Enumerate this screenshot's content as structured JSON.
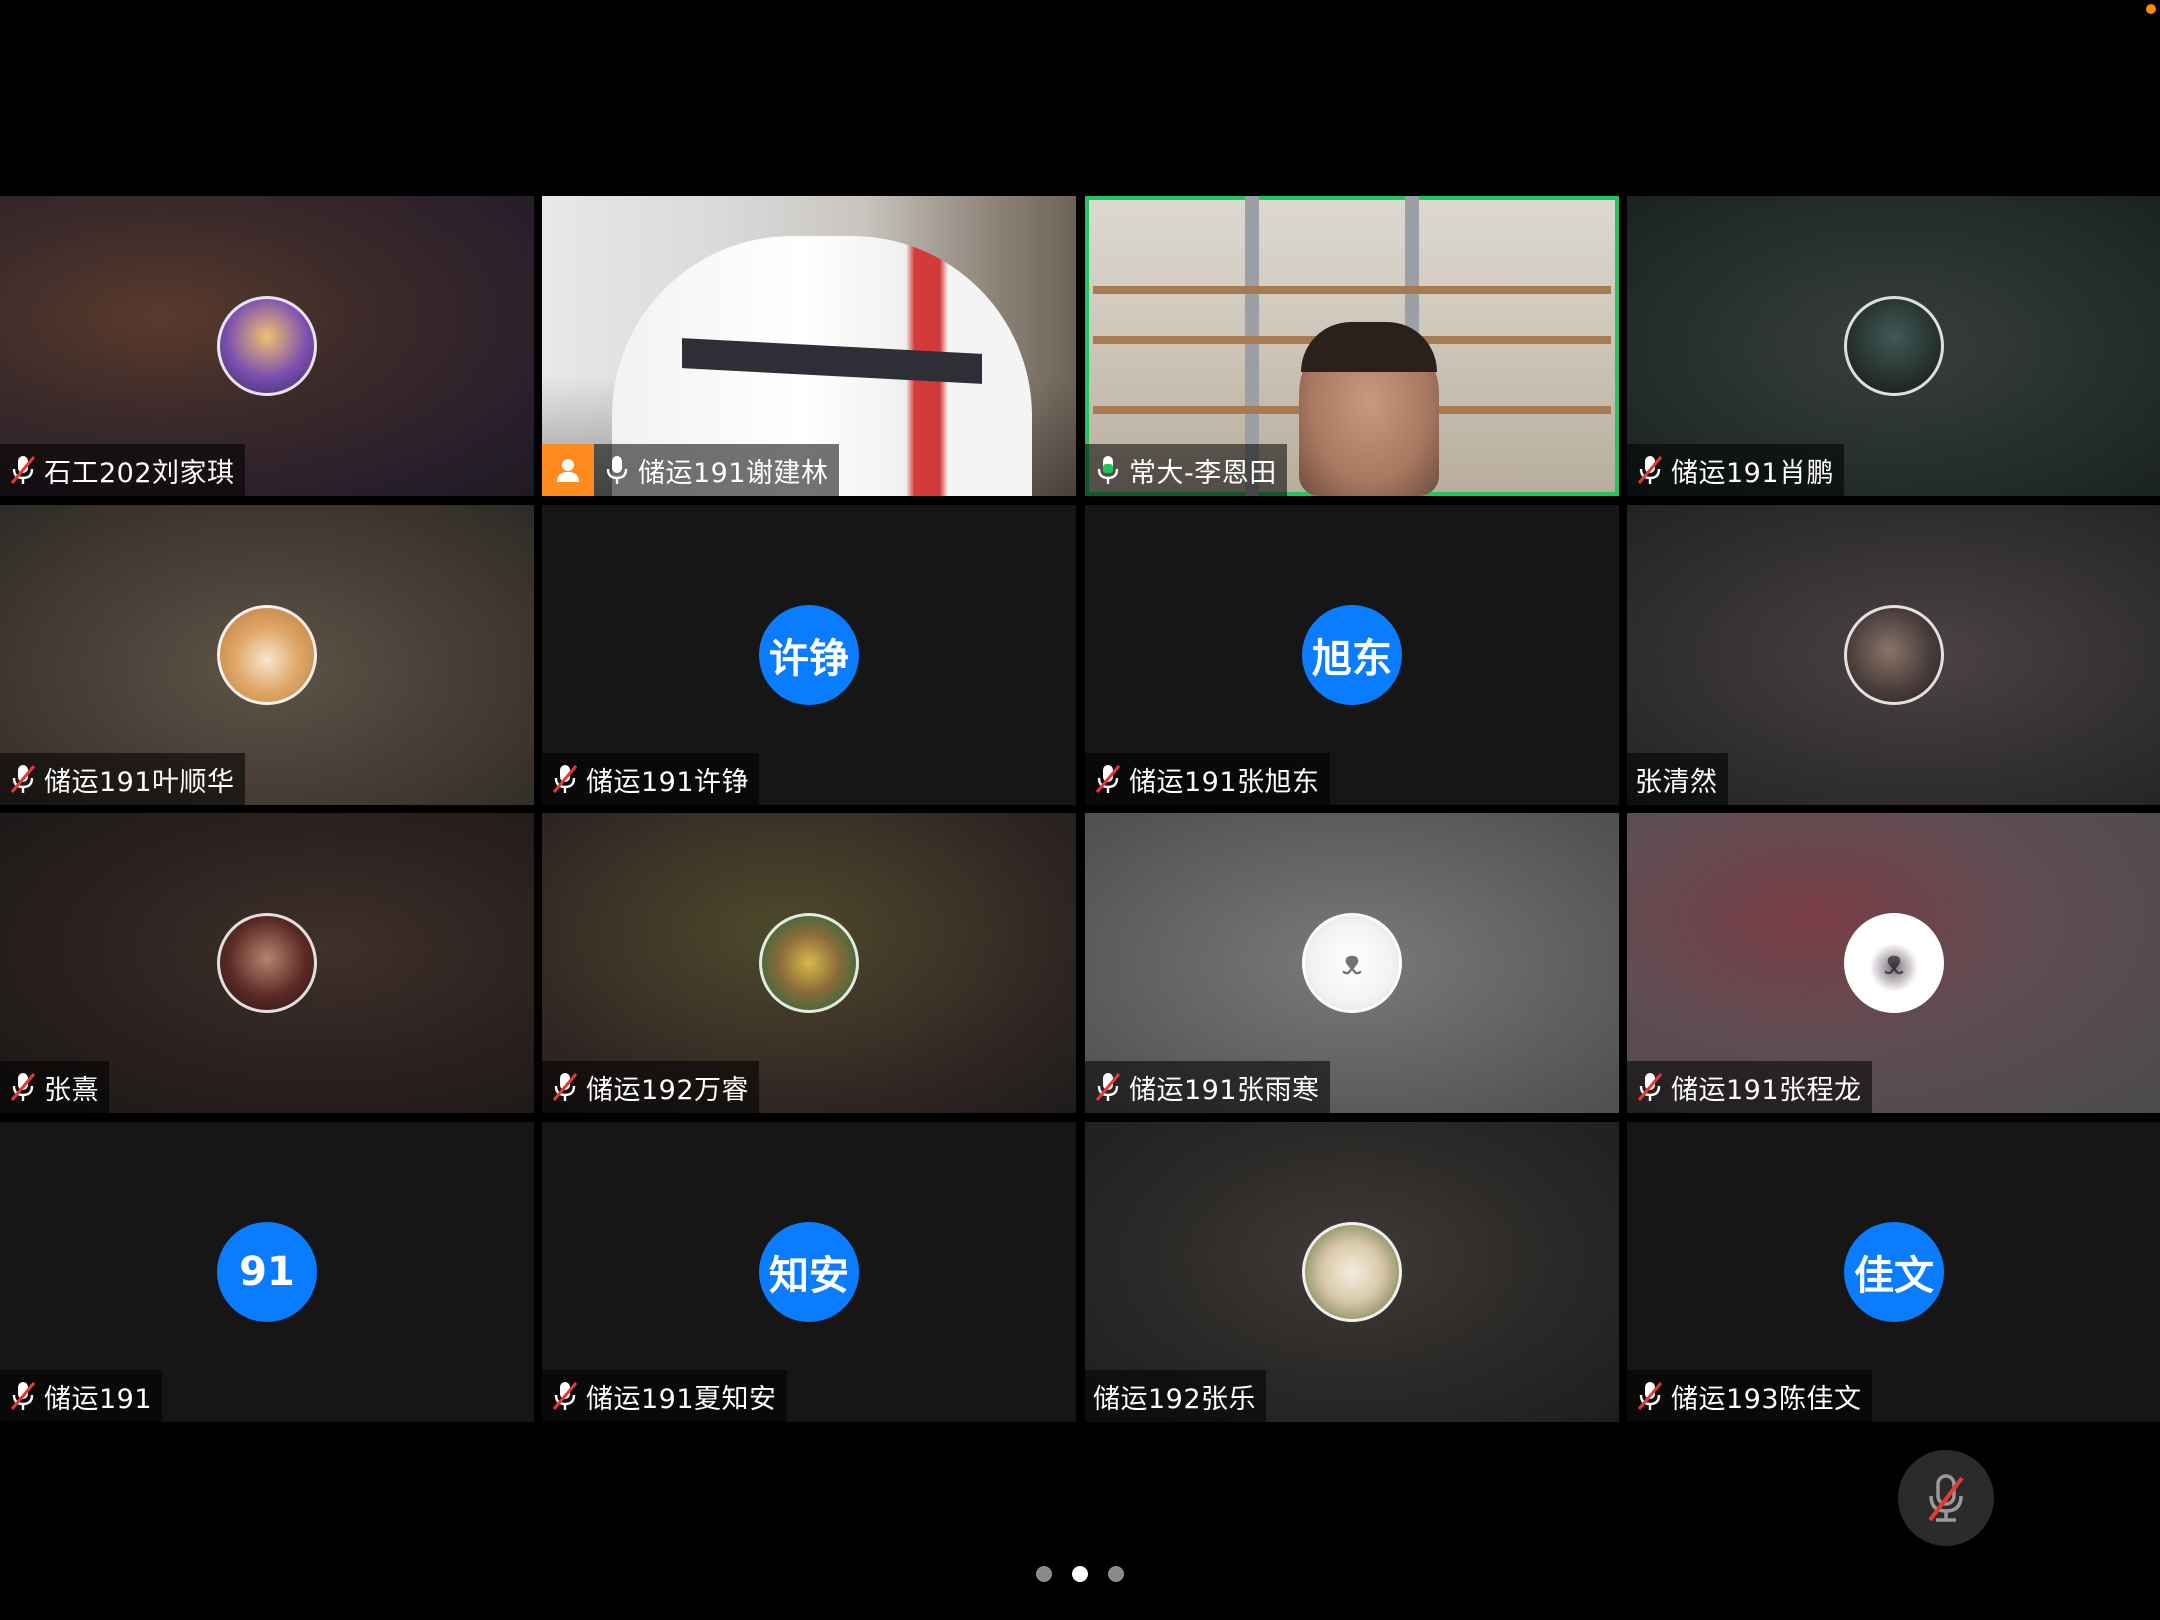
{
  "participants": [
    {
      "name": "石工202刘家琪",
      "mic": "muted",
      "avatar": "photo"
    },
    {
      "name": "储运191谢建林",
      "mic": "on",
      "host_badge": "host-icon",
      "video": "on"
    },
    {
      "name": "常大-李恩田",
      "mic": "speaking",
      "video": "on",
      "active_speaker_color": "#22c55e"
    },
    {
      "name": "储运191肖鹏",
      "mic": "muted",
      "avatar": "photo"
    },
    {
      "name": "储运191叶顺华",
      "mic": "muted",
      "avatar": "photo"
    },
    {
      "name": "储运191许铮",
      "mic": "muted",
      "initials": "许铮"
    },
    {
      "name": "储运191张旭东",
      "mic": "muted",
      "initials": "旭东"
    },
    {
      "name": "张清然",
      "mic": "none",
      "avatar": "photo"
    },
    {
      "name": "张熹",
      "mic": "muted",
      "avatar": "photo"
    },
    {
      "name": "储运192万睿",
      "mic": "muted",
      "avatar": "photo"
    },
    {
      "name": "储运191张雨寒",
      "mic": "muted",
      "avatar": "photo"
    },
    {
      "name": "储运191张程龙",
      "mic": "muted",
      "avatar": "photo"
    },
    {
      "name": "储运191",
      "mic": "muted",
      "initials": "91"
    },
    {
      "name": "储运191夏知安",
      "mic": "muted",
      "initials": "知安"
    },
    {
      "name": "储运192张乐",
      "mic": "none",
      "avatar": "photo"
    },
    {
      "name": "储运193陈佳文",
      "mic": "muted",
      "initials": "佳文"
    }
  ],
  "controls": {
    "mute_button_icon": "mic-off-icon"
  },
  "pager": {
    "pages": 3,
    "current": 2
  },
  "colors": {
    "initials_bg": "#0a7cff",
    "host_badge": "#ff8a1e",
    "muted_mic": "#e53935",
    "speaking_mic": "#22c55e"
  }
}
